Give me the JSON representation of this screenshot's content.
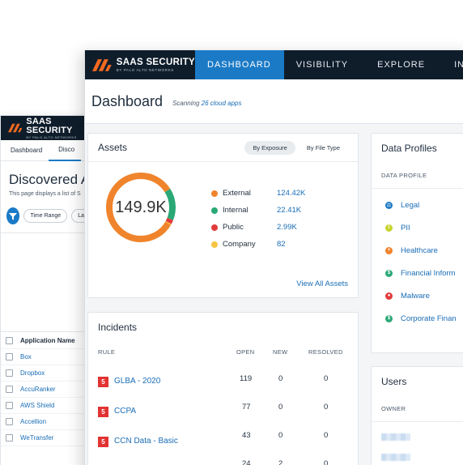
{
  "back": {
    "brand": "SAAS SECURITY",
    "brand_sub": "BY PALO ALTO NETWORKS",
    "tabs": [
      "Dashboard",
      "Disco"
    ],
    "title": "Discovered Ap",
    "subtitle": "This page displays a list of S",
    "filters": [
      "Time Range",
      "La"
    ],
    "col_header": "Application Name",
    "apps": [
      "Box",
      "Dropbox",
      "AccuRanker",
      "AWS Shield",
      "Accellion",
      "WeTransfer"
    ]
  },
  "front": {
    "brand": "SAAS SECURITY",
    "brand_sub": "BY PALO ALTO NETWORKS",
    "nav": [
      "DASHBOARD",
      "VISIBILITY",
      "EXPLORE",
      "INCIDENTS"
    ],
    "title": "Dashboard",
    "scanning_prefix": "Scanning",
    "scanning_link": "26 cloud apps",
    "assets": {
      "title": "Assets",
      "toggle": [
        "By Exposure",
        "By File Type"
      ],
      "total": "149.9K",
      "legend": [
        {
          "name": "External",
          "value": "124.42K",
          "color": "#f0842c"
        },
        {
          "name": "Internal",
          "value": "22.41K",
          "color": "#2aa876"
        },
        {
          "name": "Public",
          "value": "2.99K",
          "color": "#e23b3b"
        },
        {
          "name": "Company",
          "value": "82",
          "color": "#f5c543"
        }
      ],
      "view_all": "View All Assets"
    },
    "incidents": {
      "title": "Incidents",
      "cols": [
        "RULE",
        "OPEN",
        "NEW",
        "RESOLVED"
      ],
      "rows": [
        {
          "sev": "5",
          "rule": "GLBA - 2020",
          "open": "119",
          "new": "0",
          "resolved": "0"
        },
        {
          "sev": "5",
          "rule": "CCPA",
          "open": "77",
          "new": "0",
          "resolved": "0"
        },
        {
          "sev": "5",
          "rule": "CCN Data - Basic",
          "open": "43",
          "new": "0",
          "resolved": "0"
        },
        {
          "sev": "",
          "rule": "",
          "open": "24",
          "new": "2",
          "resolved": "0"
        }
      ]
    },
    "profiles": {
      "title": "Data Profiles",
      "col": "DATA PROFILE",
      "items": [
        {
          "name": "Legal",
          "color": "#1b7ac6",
          "icon": "legal-icon",
          "glyph": "⚖"
        },
        {
          "name": "PII",
          "color": "#c8d430",
          "icon": "pii-icon",
          "glyph": "I"
        },
        {
          "name": "Healthcare",
          "color": "#f0842c",
          "icon": "healthcare-icon",
          "glyph": "+"
        },
        {
          "name": "Financial Inform",
          "color": "#2aa876",
          "icon": "financial-icon",
          "glyph": "$"
        },
        {
          "name": "Malware",
          "color": "#e23b3b",
          "icon": "malware-icon",
          "glyph": "●"
        },
        {
          "name": "Corporate Finan",
          "color": "#2aa876",
          "icon": "corporate-finance-icon",
          "glyph": "$"
        }
      ]
    },
    "users": {
      "title": "Users",
      "col": "OWNER"
    }
  }
}
